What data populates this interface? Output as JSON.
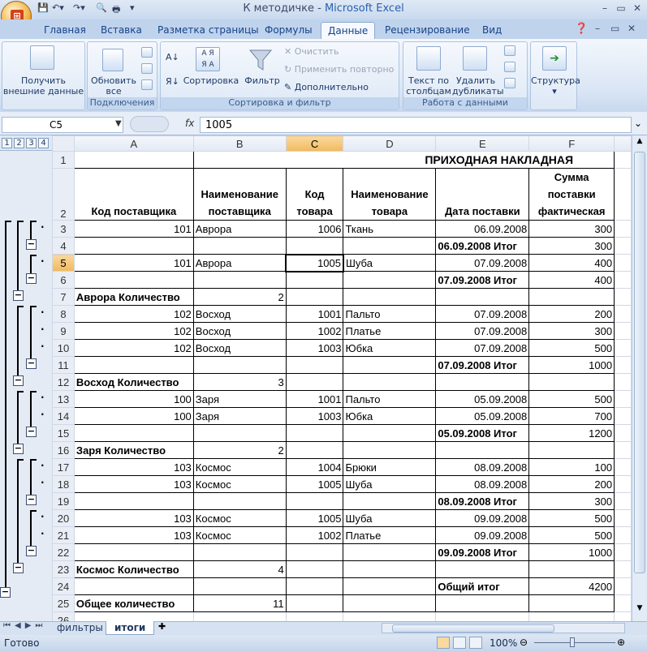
{
  "window": {
    "doc_title": "К методичке",
    "separator": " - ",
    "app_name": "Microsoft Excel",
    "min": "–",
    "max": "▭",
    "close": "✕"
  },
  "ribbon_tabs": [
    "Главная",
    "Вставка",
    "Разметка страницы",
    "Формулы",
    "Данные",
    "Рецензирование",
    "Вид"
  ],
  "active_tab": "Данные",
  "ribbon": {
    "get_external": [
      "Получить",
      "внешние данные"
    ],
    "refresh_all": [
      "Обновить",
      "все"
    ],
    "connections_label": "Подключения",
    "sort": "Сортировка",
    "filter": "Фильтр",
    "clear": "Очистить",
    "reapply": "Применить повторно",
    "advanced": "Дополнительно",
    "sort_filter_label": "Сортировка и фильтр",
    "text_to_columns": [
      "Текст по",
      "столбцам"
    ],
    "remove_dupes": [
      "Удалить",
      "дубликаты"
    ],
    "data_tools_label": "Работа с данными",
    "outline": "Структура",
    "az": "А Я",
    "aa": "Я А"
  },
  "formula_bar": {
    "name_box": "C5",
    "fx": "fx",
    "value": "1005"
  },
  "outline_levels": [
    "1",
    "2",
    "3",
    "4"
  ],
  "columns": [
    "A",
    "B",
    "C",
    "D",
    "E",
    "F"
  ],
  "selected_column": "C",
  "selected_row": "5",
  "sheet": {
    "title": "ПРИХОДНАЯ НАКЛАДНАЯ",
    "headers": [
      "Код поставщика",
      "Наименование поставщика",
      "Код товара",
      "Наименование товара",
      "Дата поставки",
      "Сумма поставки фактическая"
    ],
    "rows": [
      {
        "n": "3",
        "a": "101",
        "b": "Аврора",
        "c": "1006",
        "d": "Ткань",
        "e": "06.09.2008",
        "f": "300",
        "kind": "data"
      },
      {
        "n": "4",
        "a": "",
        "b": "",
        "c": "",
        "d": "",
        "e": "06.09.2008 Итог",
        "f": "300",
        "kind": "subtotal"
      },
      {
        "n": "5",
        "a": "101",
        "b": "Аврора",
        "c": "1005",
        "d": "Шуба",
        "e": "07.09.2008",
        "f": "400",
        "kind": "data"
      },
      {
        "n": "6",
        "a": "",
        "b": "",
        "c": "",
        "d": "",
        "e": "07.09.2008 Итог",
        "f": "400",
        "kind": "subtotal"
      },
      {
        "n": "7",
        "a": "Аврора Количество",
        "b": "2",
        "c": "",
        "d": "",
        "e": "",
        "f": "",
        "kind": "count"
      },
      {
        "n": "8",
        "a": "102",
        "b": "Восход",
        "c": "1001",
        "d": "Пальто",
        "e": "07.09.2008",
        "f": "200",
        "kind": "data"
      },
      {
        "n": "9",
        "a": "102",
        "b": "Восход",
        "c": "1002",
        "d": "Платье",
        "e": "07.09.2008",
        "f": "300",
        "kind": "data"
      },
      {
        "n": "10",
        "a": "102",
        "b": "Восход",
        "c": "1003",
        "d": "Юбка",
        "e": "07.09.2008",
        "f": "500",
        "kind": "data"
      },
      {
        "n": "11",
        "a": "",
        "b": "",
        "c": "",
        "d": "",
        "e": "07.09.2008 Итог",
        "f": "1000",
        "kind": "subtotal"
      },
      {
        "n": "12",
        "a": "Восход Количество",
        "b": "3",
        "c": "",
        "d": "",
        "e": "",
        "f": "",
        "kind": "count"
      },
      {
        "n": "13",
        "a": "100",
        "b": "Заря",
        "c": "1001",
        "d": "Пальто",
        "e": "05.09.2008",
        "f": "500",
        "kind": "data"
      },
      {
        "n": "14",
        "a": "100",
        "b": "Заря",
        "c": "1003",
        "d": "Юбка",
        "e": "05.09.2008",
        "f": "700",
        "kind": "data"
      },
      {
        "n": "15",
        "a": "",
        "b": "",
        "c": "",
        "d": "",
        "e": "05.09.2008 Итог",
        "f": "1200",
        "kind": "subtotal"
      },
      {
        "n": "16",
        "a": "Заря Количество",
        "b": "2",
        "c": "",
        "d": "",
        "e": "",
        "f": "",
        "kind": "count"
      },
      {
        "n": "17",
        "a": "103",
        "b": "Космос",
        "c": "1004",
        "d": "Брюки",
        "e": "08.09.2008",
        "f": "100",
        "kind": "data"
      },
      {
        "n": "18",
        "a": "103",
        "b": "Космос",
        "c": "1005",
        "d": "Шуба",
        "e": "08.09.2008",
        "f": "200",
        "kind": "data"
      },
      {
        "n": "19",
        "a": "",
        "b": "",
        "c": "",
        "d": "",
        "e": "08.09.2008 Итог",
        "f": "300",
        "kind": "subtotal"
      },
      {
        "n": "20",
        "a": "103",
        "b": "Космос",
        "c": "1005",
        "d": "Шуба",
        "e": "09.09.2008",
        "f": "500",
        "kind": "data"
      },
      {
        "n": "21",
        "a": "103",
        "b": "Космос",
        "c": "1002",
        "d": "Платье",
        "e": "09.09.2008",
        "f": "500",
        "kind": "data"
      },
      {
        "n": "22",
        "a": "",
        "b": "",
        "c": "",
        "d": "",
        "e": "09.09.2008 Итог",
        "f": "1000",
        "kind": "subtotal"
      },
      {
        "n": "23",
        "a": "Космос Количество",
        "b": "4",
        "c": "",
        "d": "",
        "e": "",
        "f": "",
        "kind": "count"
      },
      {
        "n": "24",
        "a": "",
        "b": "",
        "c": "",
        "d": "",
        "e": "Общий итог",
        "f": "4200",
        "kind": "grand"
      },
      {
        "n": "25",
        "a": "Общее количество",
        "b": "11",
        "c": "",
        "d": "",
        "e": "",
        "f": "",
        "kind": "count"
      },
      {
        "n": "26",
        "a": "",
        "b": "",
        "c": "",
        "d": "",
        "e": "",
        "f": "",
        "kind": "empty"
      }
    ]
  },
  "sheet_tabs": [
    "фильтры",
    "итоги"
  ],
  "active_sheet": "итоги",
  "status": {
    "ready": "Готово",
    "zoom": "100%"
  }
}
